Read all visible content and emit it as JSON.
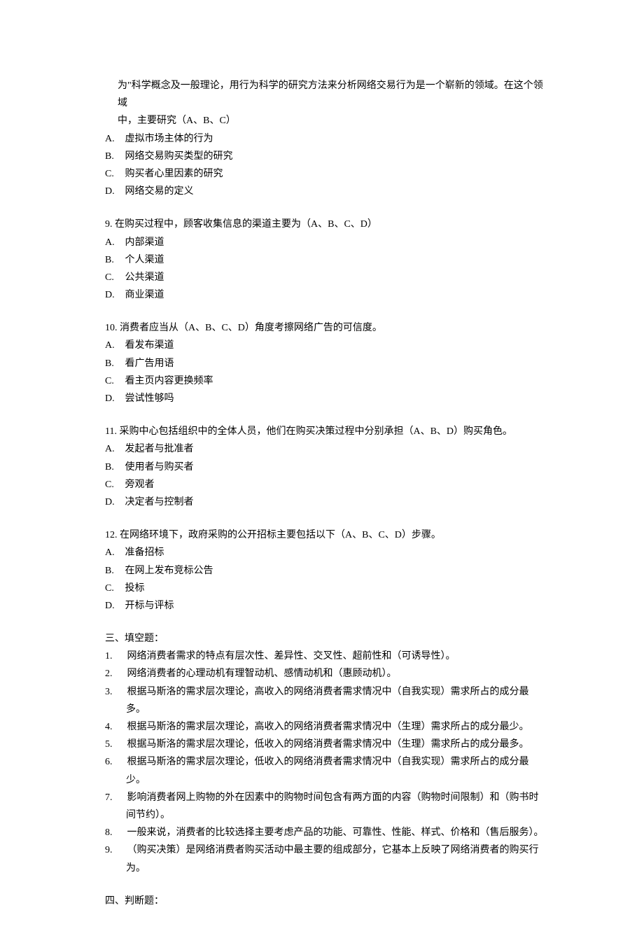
{
  "q8": {
    "stem_cont1": "为\"科学概念及一般理论，用行为科学的研究方法来分析网络交易行为是一个崭新的领域。在这个领域",
    "stem_cont2": "中，主要研究（A、B、C）",
    "A": "虚拟市场主体的行为",
    "B": "网络交易购买类型的研究",
    "C": "购买者心里因素的研究",
    "D": "网络交易的定义"
  },
  "q9": {
    "stem": "9.    在购买过程中，顾客收集信息的渠道主要为（A、B、C、D）",
    "A": "内部渠道",
    "B": "个人渠道",
    "C": "公共渠道",
    "D": "商业渠道"
  },
  "q10": {
    "stem": "10.  消费者应当从（A、B、C、D）角度考擦网络广告的可信度。",
    "A": "看发布渠道",
    "B": "看广告用语",
    "C": "看主页内容更换频率",
    "D": "尝试性够吗"
  },
  "q11": {
    "stem": "11.  采购中心包括组织中的全体人员，他们在购买决策过程中分别承担（A、B、D）购买角色。",
    "A": "发起者与批准者",
    "B": "使用者与购买者",
    "C": "旁观者",
    "D": "决定者与控制者"
  },
  "q12": {
    "stem": "12.  在网络环境下，政府采购的公开招标主要包括以下（A、B、C、D）步骤。",
    "A": "准备招标",
    "B": "在网上发布竞标公告",
    "C": "投标",
    "D": "开标与评标"
  },
  "section3": {
    "heading": "三、填空题：",
    "items": [
      "网络消费者需求的特点有层次性、差异性、交叉性、超前性和（可诱导性）。",
      "网络消费者的心理动机有理智动机、感情动机和（惠顾动机）。",
      "根据马斯洛的需求层次理论，高收入的网络消费者需求情况中（自我实现）需求所占的成分最多。",
      "根据马斯洛的需求层次理论，高收入的网络消费者需求情况中（生理）需求所占的成分最少。",
      "根据马斯洛的需求层次理论，低收入的网络消费者需求情况中（生理）需求所占的成分最多。",
      "根据马斯洛的需求层次理论，低收入的网络消费者需求情况中（自我实现）需求所占的成分最少。",
      "影响消费者网上购物的外在因素中的购物时间包含有两方面的内容（购物时间限制）和（购书时间节约）。",
      "一般来说，消费者的比较选择主要考虑产品的功能、可靠性、性能、样式、价格和（售后服务）。",
      "（购买决策）是网络消费者购买活动中最主要的组成部分，它基本上反映了网络消费者的购买行为。"
    ]
  },
  "section4": {
    "heading": "四、判断题："
  },
  "labels": {
    "A": "A.",
    "B": "B.",
    "C": "C.",
    "D": "D."
  }
}
